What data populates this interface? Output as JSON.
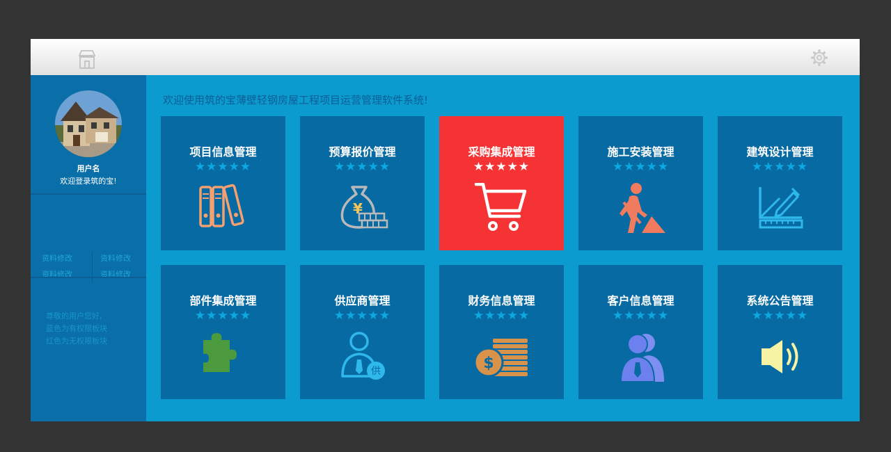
{
  "welcome_text": "欢迎使用筑的宝薄壁轻钢房屋工程项目运营管理软件系统!",
  "topbar": {
    "home_icon": "store-icon",
    "settings_icon": "gear-icon"
  },
  "sidebar": {
    "user_name": "用户名",
    "user_welcome": "欢迎登录筑的宝!",
    "links": [
      "资料修改",
      "资料修改",
      "资料修改",
      "资料修改"
    ],
    "notice": [
      "尊敬的用户您好,",
      "蓝色为有权限板块",
      "红色为无权限板块"
    ]
  },
  "tiles": [
    {
      "title": "项目信息管理",
      "stars": "★★★★★",
      "icon": "binders-icon",
      "active": false
    },
    {
      "title": "预算报价管理",
      "stars": "★★★★★",
      "icon": "money-bag-icon",
      "active": false
    },
    {
      "title": "采购集成管理",
      "stars": "★★★★★",
      "icon": "shopping-cart-icon",
      "active": true
    },
    {
      "title": "施工安装管理",
      "stars": "★★★★★",
      "icon": "construction-worker-icon",
      "active": false
    },
    {
      "title": "建筑设计管理",
      "stars": "★★★★★",
      "icon": "drafting-tools-icon",
      "active": false
    },
    {
      "title": "部件集成管理",
      "stars": "★★★★★",
      "icon": "puzzle-piece-icon",
      "active": false
    },
    {
      "title": "供应商管理",
      "stars": "★★★★★",
      "icon": "supplier-user-icon",
      "active": false
    },
    {
      "title": "财务信息管理",
      "stars": "★★★★★",
      "icon": "coins-icon",
      "active": false
    },
    {
      "title": "客户信息管理",
      "stars": "★★★★★",
      "icon": "users-icon",
      "active": false
    },
    {
      "title": "系统公告管理",
      "stars": "★★★★★",
      "icon": "speaker-icon",
      "active": false
    }
  ],
  "icon_labels": {
    "supplier_badge": "供",
    "coin_symbol": "$",
    "yuan_symbol": "¥"
  },
  "colors": {
    "page_background": "#333333",
    "panel_blue": "#0c9bcf",
    "sidebar_blue": "#0a6ea8",
    "tile_blue": "#086aa2",
    "tile_active_red": "#f53234",
    "star_blue": "#0da8e0"
  }
}
